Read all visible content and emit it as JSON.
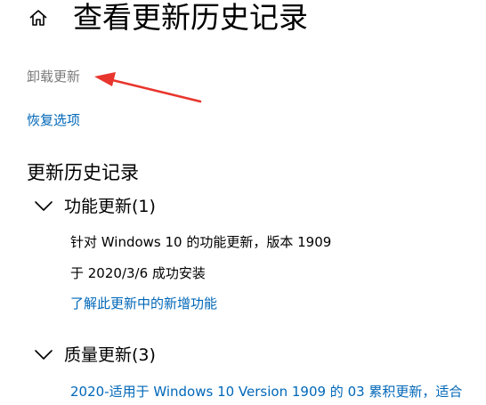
{
  "header": {
    "home_icon": "home-icon",
    "title": "查看更新历史记录"
  },
  "actions": {
    "uninstall_label": "卸载更新",
    "recovery_label": "恢复选项"
  },
  "annotation": {
    "arrow_color": "#e8352d"
  },
  "history": {
    "section_title": "更新历史记录",
    "groups": [
      {
        "label": "功能更新(1)",
        "expanded": true,
        "items": [
          {
            "name": "针对 Windows 10 的功能更新，版本 1909",
            "status": "于 2020/3/6 成功安装",
            "link": "了解此更新中的新增功能"
          }
        ]
      },
      {
        "label": "质量更新(3)",
        "expanded": true,
        "items": [
          {
            "name": "2020-适用于 Windows 10 Version 1909 的 03 累积更新，适合"
          }
        ]
      }
    ]
  },
  "colors": {
    "link": "#0067b8",
    "muted": "#7a7a7a",
    "text": "#000000",
    "background": "#ffffff"
  }
}
